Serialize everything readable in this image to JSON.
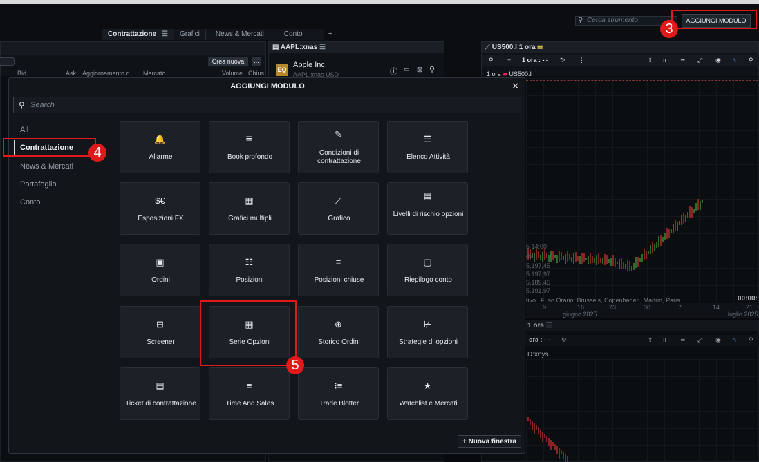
{
  "top": {
    "search_placeholder": "Cerca strumento",
    "add_module_button": "AGGIUNGI MODULO"
  },
  "tabs": [
    {
      "label": "Contrattazione"
    },
    {
      "label": "Grafici"
    },
    {
      "label": "News & Mercati"
    },
    {
      "label": "Conto"
    }
  ],
  "tab_plus": "+",
  "left_panel": {
    "create_new": "Crea nuova",
    "more": "...",
    "col_bid": "Bid",
    "col_ask": "Ask",
    "col_update": "Aggiornamento d...",
    "col_market": "Mercato",
    "col_volume": "Volume",
    "col_close": "Chius"
  },
  "aapl_panel": {
    "title": "AAPL:xnas",
    "badge": "EQ",
    "name": "Apple Inc.",
    "sub": "AAPL:xnas USD"
  },
  "chart_panel": {
    "title": "US500.I 1 ora",
    "interval": "1 ora : - -",
    "legend": "1 ora",
    "legend_sym": "US500.I",
    "tooltip_time": "5 14:00",
    "tooltip_d": "d)",
    "tooltip_vals": [
      "5.197,45",
      "5.197,97",
      "5.189,45",
      "5.191,97"
    ],
    "timezone_label": "tivo",
    "timezone": "Fuso Orario: Brussels, Copenhagen, Madrid, Paris",
    "time_right": "00:00:",
    "x_ticks": [
      "9",
      "16",
      "23",
      "30",
      "7",
      "14",
      "21"
    ],
    "month_left": "giugno 2025",
    "month_right": "luglio 2025",
    "bottom_title": "1 ora",
    "bottom_interval": "ora : - -",
    "bottom_sym": "D:xnys"
  },
  "modal": {
    "title": "AGGIUNGI MODULO",
    "search_placeholder": "Search",
    "categories": [
      "All",
      "Contrattazione",
      "News & Mercati",
      "Portafoglio",
      "Conto"
    ],
    "active_category": "Contrattazione",
    "tiles": [
      {
        "label": "Allarme",
        "icon": "bell-icon",
        "glyph": "🔔"
      },
      {
        "label": "Book profondo",
        "icon": "book-icon",
        "glyph": "≣"
      },
      {
        "label": "Condizioni di contrattazione",
        "icon": "edit-doc-icon",
        "glyph": "✎"
      },
      {
        "label": "Elenco Attività",
        "icon": "list-icon",
        "glyph": "☰"
      },
      {
        "label": "Esposizioni FX",
        "icon": "fx-icon",
        "glyph": "$€"
      },
      {
        "label": "Grafici multipli",
        "icon": "multi-chart-icon",
        "glyph": "▦"
      },
      {
        "label": "Grafico",
        "icon": "line-chart-icon",
        "glyph": "⟋"
      },
      {
        "label": "Livelli di rischio opzioni",
        "icon": "risk-grid-icon",
        "glyph": "▤"
      },
      {
        "label": "Ordini",
        "icon": "orders-icon",
        "glyph": "▣"
      },
      {
        "label": "Posizioni",
        "icon": "positions-icon",
        "glyph": "☷"
      },
      {
        "label": "Posizioni chiuse",
        "icon": "closed-positions-icon",
        "glyph": "≡"
      },
      {
        "label": "Riepilogo conto",
        "icon": "account-summary-icon",
        "glyph": "▢"
      },
      {
        "label": "Screener",
        "icon": "screener-icon",
        "glyph": "⊟"
      },
      {
        "label": "Serie Opzioni",
        "icon": "options-grid-icon",
        "glyph": "▦"
      },
      {
        "label": "Storico Ordini",
        "icon": "order-history-icon",
        "glyph": "⊕"
      },
      {
        "label": "Strategie di opzioni",
        "icon": "strategy-icon",
        "glyph": "⊬"
      },
      {
        "label": "Ticket di contrattazione",
        "icon": "ticket-icon",
        "glyph": "▤"
      },
      {
        "label": "Time And Sales",
        "icon": "time-sales-icon",
        "glyph": "≡"
      },
      {
        "label": "Trade Blotter",
        "icon": "blotter-icon",
        "glyph": "⁝≡"
      },
      {
        "label": "Watchlist e Mercati",
        "icon": "star-icon",
        "glyph": "★"
      }
    ],
    "new_window": "+ Nuova finestra"
  },
  "annotations": {
    "badge3": "3",
    "badge4": "4",
    "badge5": "5",
    "color": "#e01a1a"
  }
}
